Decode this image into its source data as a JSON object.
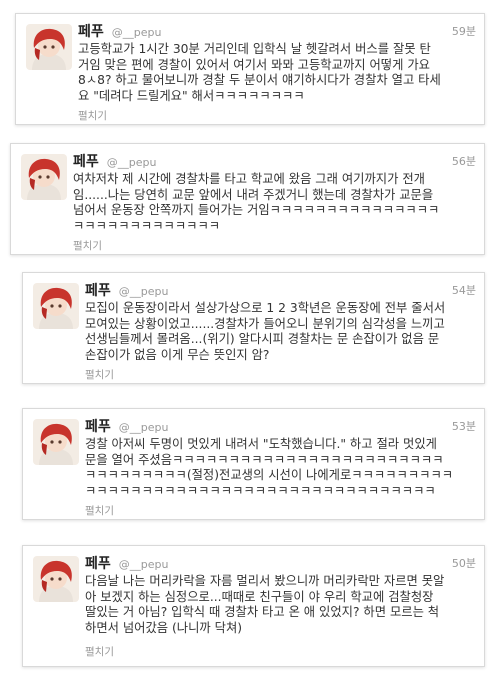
{
  "colors": {
    "name": "#222222",
    "text": "#333333",
    "muted": "#999999",
    "border": "#d9d9d9"
  },
  "tweets": [
    {
      "name": "페푸",
      "handle": "@__pepu",
      "time": "59분",
      "lines": [
        "고등학교가 1시간 30분 거리인데 입학식 날 헷갈려서 버스를 잘못 탄",
        "거임 맞은 편에 경찰이 있어서 여기서 뫄뫄 고등학교까지 어떻게 가요",
        "8ㅅ8? 하고 물어보니까 경찰 두 분이서 얘기하시다가 경찰차 열고 타세",
        "요 \"데려다 드릴게요\" 해서ㅋㅋㅋㅋㅋㅋㅋㅋ"
      ],
      "expand": "펼치기"
    },
    {
      "name": "페푸",
      "handle": "@__pepu",
      "time": "56분",
      "lines": [
        "여차저차 제 시간에 경찰차를 타고 학교에 왔음 그래 여기까지가 전개",
        "임......나는 당연히 교문 앞에서 내려 주겠거니 했는데 경찰차가 교문을",
        "넘어서 운동장 안쪽까지 들어가는 거임ㅋㅋㅋㅋㅋㅋㅋㅋㅋㅋㅋㅋㅋㅋㅋ",
        "ㅋㅋㅋㅋㅋㅋㅋㅋㅋㅋㅋㅋㅋ"
      ],
      "expand": "펼치기"
    },
    {
      "name": "페푸",
      "handle": "@__pepu",
      "time": "54분",
      "lines": [
        "모집이 운동장이라서 설상가상으로 1 2 3학년은 운동장에 전부 줄서서",
        "모여있는 상황이었고......경찰차가 들어오니 분위기의 심각성을 느끼고",
        "선생님들께서 몰려옴...(위기) 알다시피 경찰차는 문 손잡이가 없음 문",
        "손잡이가 없음 이게 무슨 뜻인지 암?"
      ],
      "expand": "펼치기"
    },
    {
      "name": "페푸",
      "handle": "@__pepu",
      "time": "53분",
      "lines": [
        "경찰 아저씨 두명이 멋있게 내려서 \"도착했습니다.\" 하고 절라 멋있게",
        "문을 열어 주셨음ㅋㅋㅋㅋㅋㅋㅋㅋㅋㅋㅋㅋㅋㅋㅋㅋㅋㅋㅋㅋㅋㅋㅋㅋ",
        "ㅋㅋㅋㅋㅋㅋㅋㅋㅋ(절정)전교생의 시선이 나에게로ㅋㅋㅋㅋㅋㅋㅋㅋㅋ",
        "ㅋㅋㅋㅋㅋㅋㅋㅋㅋㅋㅋㅋㅋㅋㅋㅋㅋㅋㅋㅋㅋㅋㅋㅋㅋㅋㅋㅋㅋㅋㅋ"
      ],
      "expand": "펼치기"
    },
    {
      "name": "페푸",
      "handle": "@__pepu",
      "time": "50분",
      "lines": [
        "다음날 나는 머리카락을 자름 멀리서 봤으니까 머리카락만 자르면 못알",
        "아 보겠지 하는 심정으로...때때로 친구들이 야 우리 학교에 검찰청장",
        "딸있는 거 아님? 입학식 때 경찰차 타고 온 애 있었지? 하면 모르는 척",
        "하면서 넘어갔음 (나니까 닥쳐)"
      ],
      "expand": "펼치기"
    }
  ]
}
